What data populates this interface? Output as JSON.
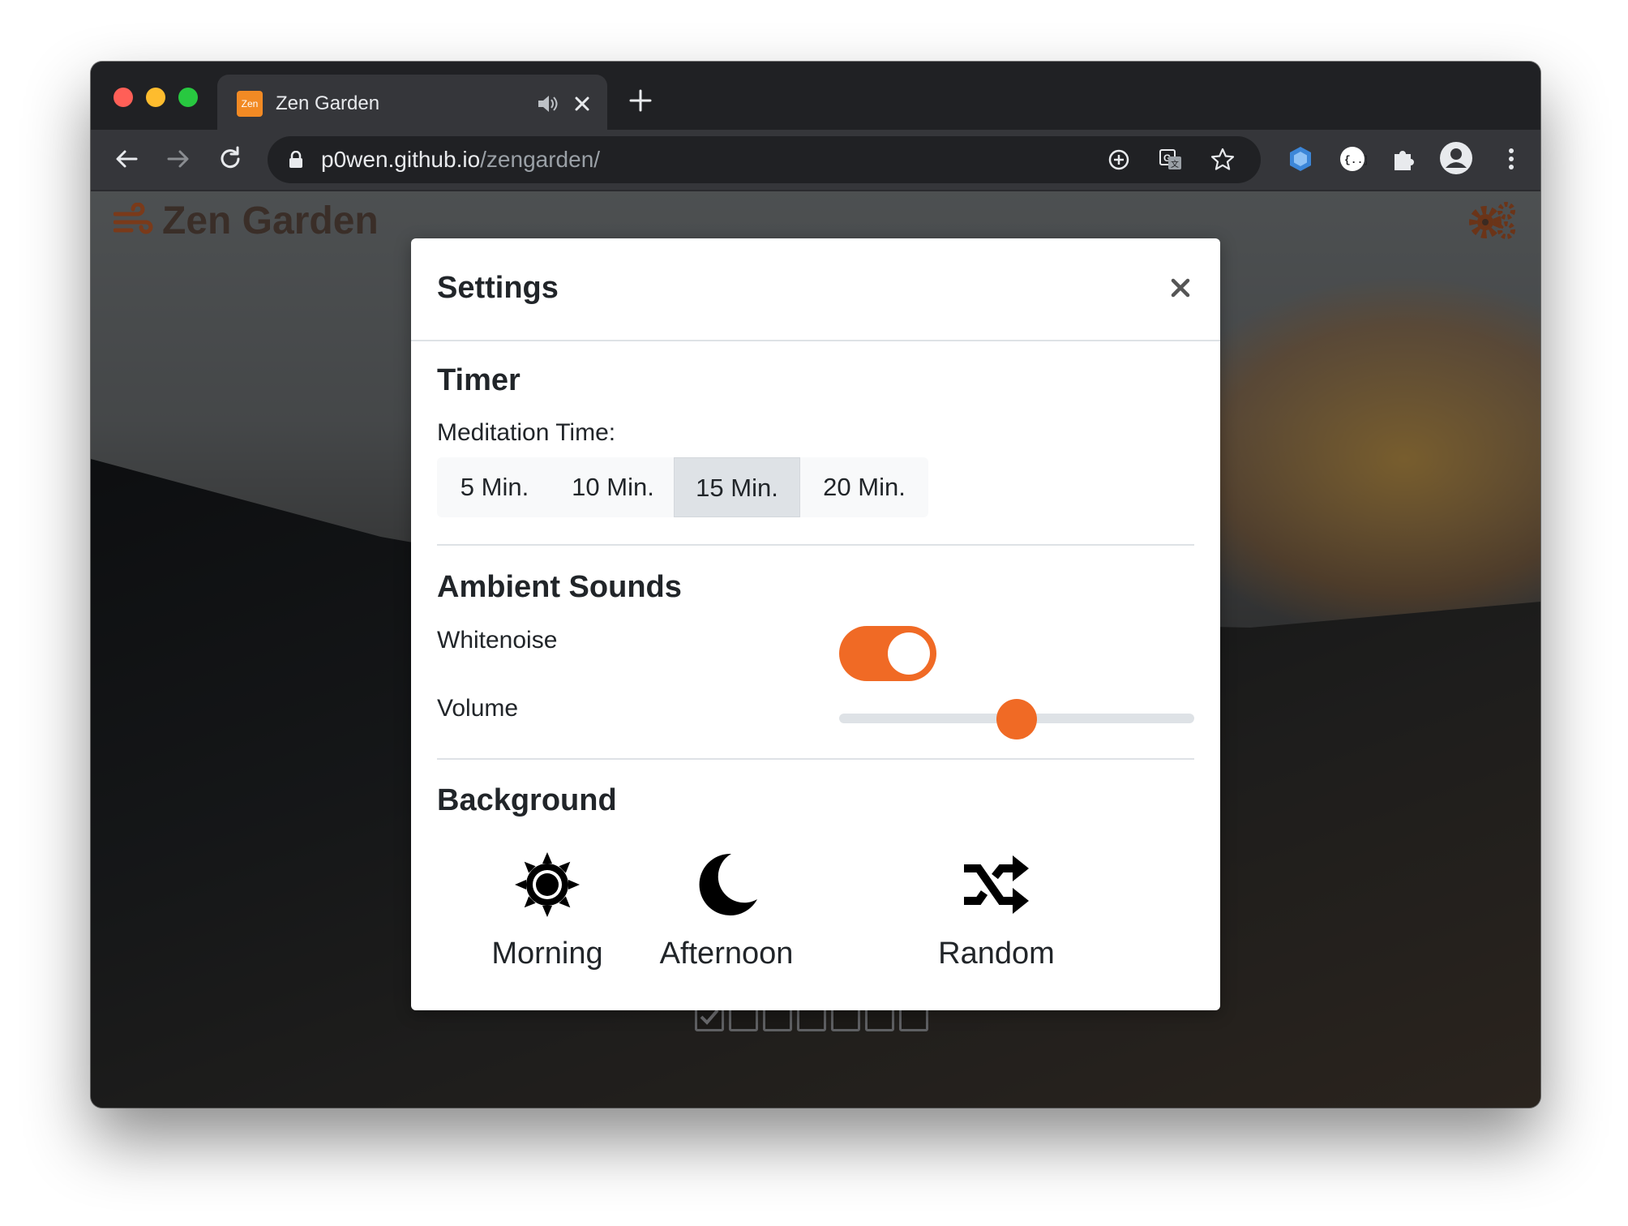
{
  "browser": {
    "tab": {
      "favicon_text": "Zen",
      "title": "Zen Garden"
    },
    "url": {
      "host": "p0wen.github.io",
      "path": "/zengarden/"
    },
    "colors": {
      "close": "#ff5f57",
      "minimize": "#febc2e",
      "maximize": "#28c840"
    }
  },
  "app": {
    "brand": "Zen Garden",
    "accent_color": "#f06a25",
    "progress": {
      "total": 7,
      "completed": 1
    }
  },
  "settings": {
    "title": "Settings",
    "timer": {
      "heading": "Timer",
      "label": "Meditation Time:",
      "options": [
        "5 Min.",
        "10 Min.",
        "15 Min.",
        "20 Min."
      ],
      "selected": "15 Min."
    },
    "ambient": {
      "heading": "Ambient Sounds",
      "whitenoise_label": "Whitenoise",
      "whitenoise_on": true,
      "volume_label": "Volume",
      "volume_fraction": 0.5
    },
    "background": {
      "heading": "Background",
      "options": [
        {
          "label": "Morning",
          "icon": "sun-icon"
        },
        {
          "label": "Afternoon",
          "icon": "moon-icon"
        },
        {
          "label": "Random",
          "icon": "shuffle-icon"
        }
      ]
    }
  }
}
